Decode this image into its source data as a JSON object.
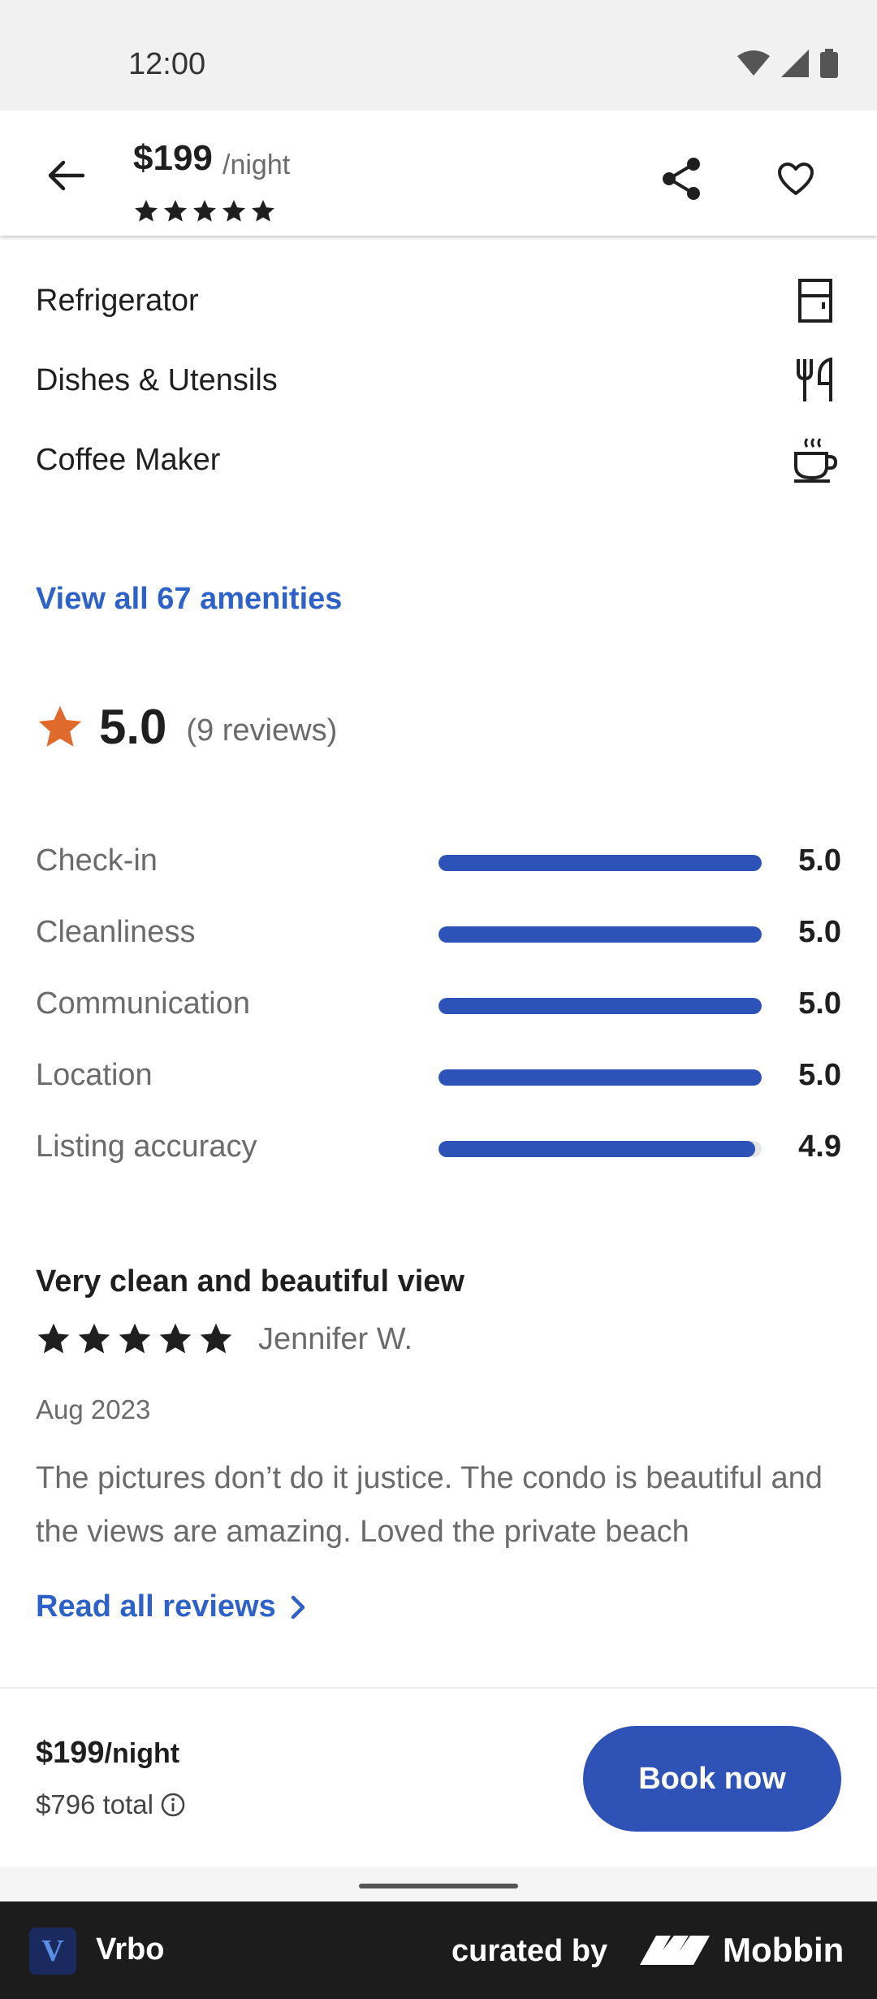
{
  "status_bar": {
    "time": "12:00"
  },
  "header": {
    "price": "$199",
    "per_night": "/night",
    "star_count": 5
  },
  "amenities": [
    {
      "label": "Refrigerator",
      "icon": "refrigerator-icon"
    },
    {
      "label": "Dishes & Utensils",
      "icon": "utensils-icon"
    },
    {
      "label": "Coffee Maker",
      "icon": "coffee-icon"
    }
  ],
  "view_all_amenities": "View all 67 amenities",
  "rating": {
    "value": "5.0",
    "count": "(9 reviews)"
  },
  "scores": [
    {
      "label": "Check-in",
      "value": "5.0",
      "fraction": 1.0
    },
    {
      "label": "Cleanliness",
      "value": "5.0",
      "fraction": 1.0
    },
    {
      "label": "Communication",
      "value": "5.0",
      "fraction": 1.0
    },
    {
      "label": "Location",
      "value": "5.0",
      "fraction": 1.0
    },
    {
      "label": "Listing accuracy",
      "value": "4.9",
      "fraction": 0.98
    }
  ],
  "review": {
    "title": "Very clean and beautiful view",
    "stars": 5,
    "author": "Jennifer W.",
    "date": "Aug 2023",
    "text": "The pictures don’t do it justice. The condo is beautiful and the views are amazing. Loved the private beach"
  },
  "read_all_reviews": "Read all reviews",
  "booking": {
    "price": "$199",
    "per_night": "/night",
    "total": "$796 total",
    "book_label": "Book now"
  },
  "footer": {
    "app_name": "Vrbo",
    "curated_by": "curated by",
    "brand": "Mobbin"
  },
  "colors": {
    "accent": "#2e52b5",
    "link": "#2f62c8",
    "rating_star": "#e06a2c"
  }
}
